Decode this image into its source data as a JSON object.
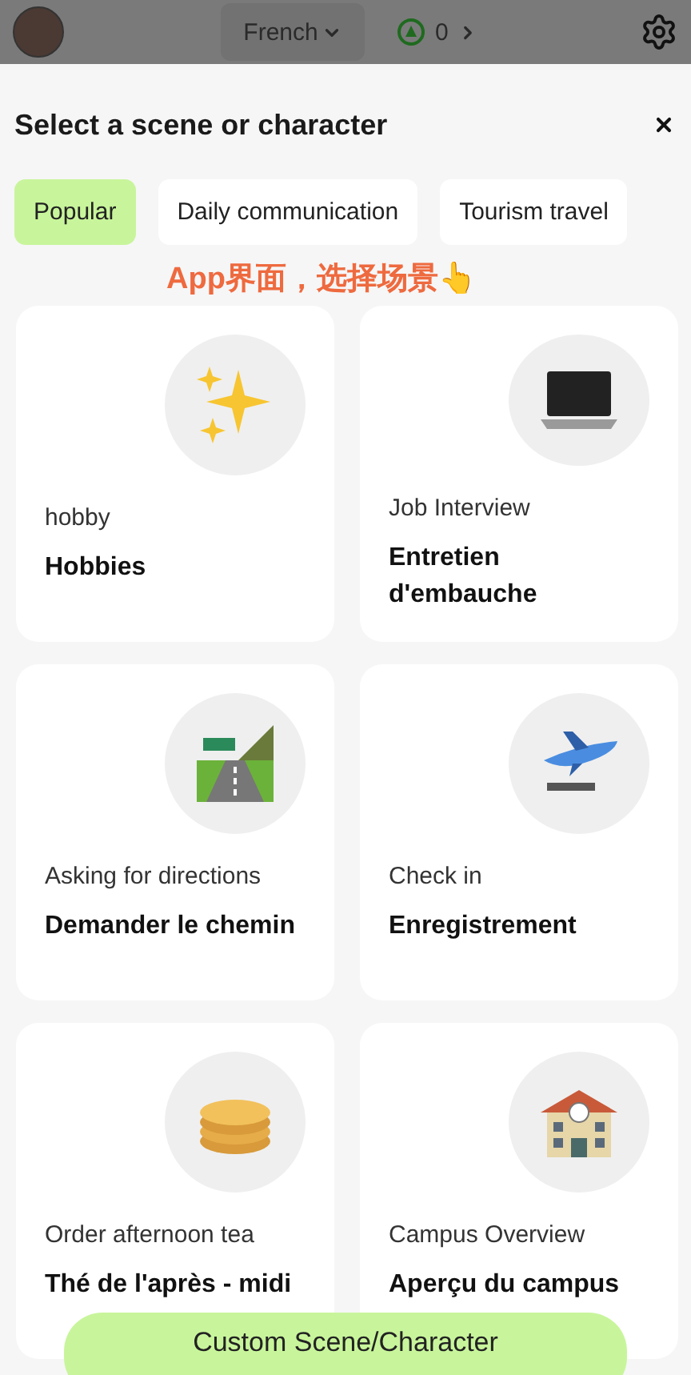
{
  "top_bar": {
    "language": "French",
    "points": "0"
  },
  "sheet": {
    "title": "Select a scene or character"
  },
  "tabs": [
    {
      "label": "Popular",
      "selected": true
    },
    {
      "label": "Daily communication",
      "selected": false
    },
    {
      "label": "Tourism travel",
      "selected": false
    }
  ],
  "caption": "App界面，选择场景👆",
  "scenes": [
    {
      "kind": "sparkles",
      "english": "hobby",
      "title": "Hobbies"
    },
    {
      "kind": "laptop",
      "english": "Job Interview",
      "title": "Entretien d'embauche"
    },
    {
      "kind": "road",
      "english": "Asking for directions",
      "title": "Demander le chemin"
    },
    {
      "kind": "airplane",
      "english": "Check in",
      "title": "Enregistrement"
    },
    {
      "kind": "pancakes",
      "english": "Order afternoon tea",
      "title": "Thé de l'après - midi"
    },
    {
      "kind": "building",
      "english": "Campus Overview",
      "title": "Aperçu du campus"
    }
  ],
  "custom_button": "Custom Scene/Character"
}
